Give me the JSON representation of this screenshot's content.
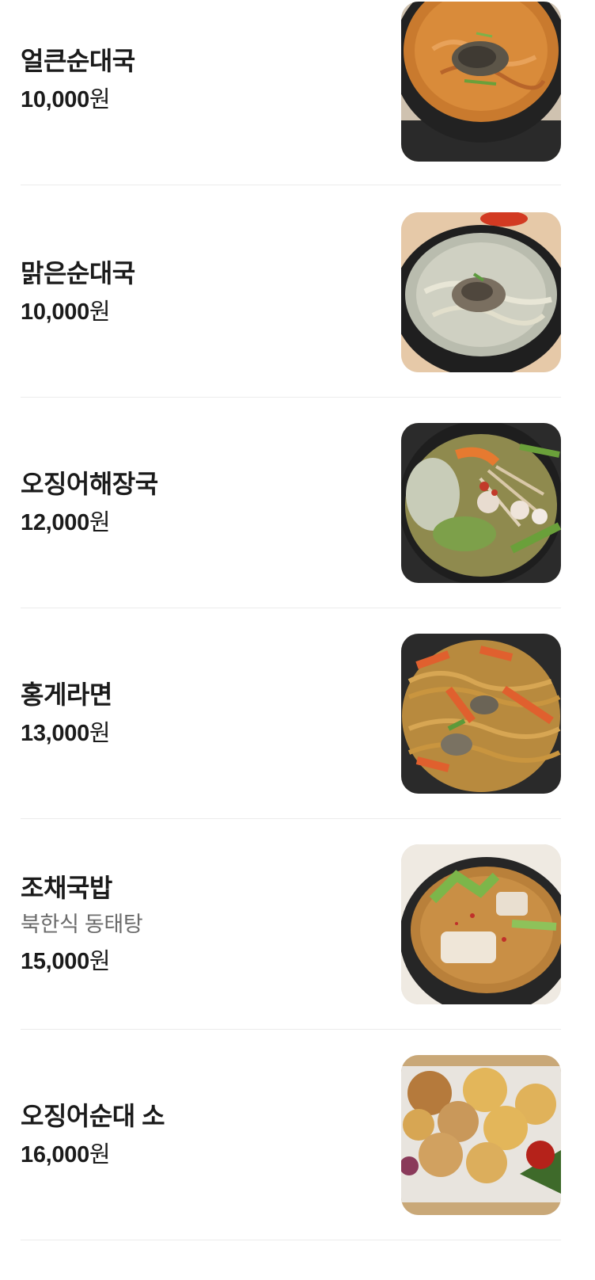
{
  "menu": {
    "items": [
      {
        "name": "얼큰순대국",
        "description": "",
        "price": "10,000",
        "unit": "원",
        "image": "spicy-sundae-soup-photo"
      },
      {
        "name": "맑은순대국",
        "description": "",
        "price": "10,000",
        "unit": "원",
        "image": "clear-sundae-soup-photo"
      },
      {
        "name": "오징어해장국",
        "description": "",
        "price": "12,000",
        "unit": "원",
        "image": "squid-hangover-soup-photo"
      },
      {
        "name": "홍게라면",
        "description": "",
        "price": "13,000",
        "unit": "원",
        "image": "red-crab-ramen-photo"
      },
      {
        "name": "조채국밥",
        "description": "북한식 동태탕",
        "price": "15,000",
        "unit": "원",
        "image": "pollack-rice-soup-photo"
      },
      {
        "name": "오징어순대 소",
        "description": "",
        "price": "16,000",
        "unit": "원",
        "image": "squid-sundae-plate-photo"
      }
    ]
  },
  "colors": {
    "text": "#1b1b1b",
    "subtext": "#6b6b6b",
    "divider": "#ececec"
  }
}
